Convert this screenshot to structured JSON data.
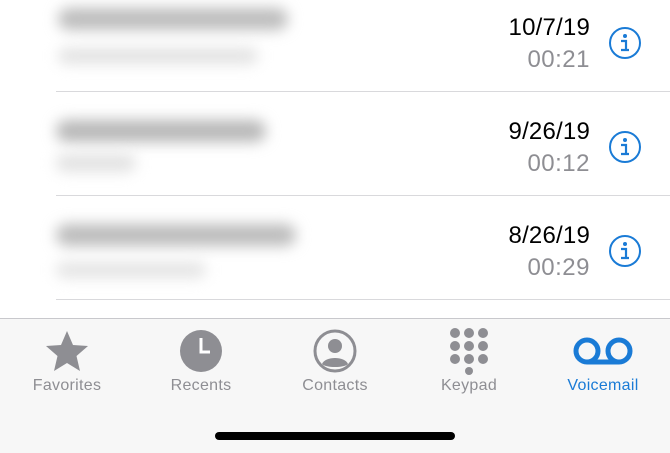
{
  "voicemails": [
    {
      "caller": "",
      "date": "10/7/19",
      "duration": "00:21"
    },
    {
      "caller": "",
      "date": "9/26/19",
      "duration": "00:12"
    },
    {
      "caller": "",
      "date": "8/26/19",
      "duration": "00:29"
    }
  ],
  "tabs": [
    {
      "label": "Favorites",
      "icon": "star-icon",
      "active": false
    },
    {
      "label": "Recents",
      "icon": "clock-icon",
      "active": false
    },
    {
      "label": "Contacts",
      "icon": "person-circle-icon",
      "active": false
    },
    {
      "label": "Keypad",
      "icon": "keypad-icon",
      "active": false
    },
    {
      "label": "Voicemail",
      "icon": "voicemail-icon",
      "active": true
    }
  ],
  "colors": {
    "accent": "#1a7bd6",
    "inactive": "#8e8e93",
    "tabbar_bg": "#f7f7f7"
  }
}
